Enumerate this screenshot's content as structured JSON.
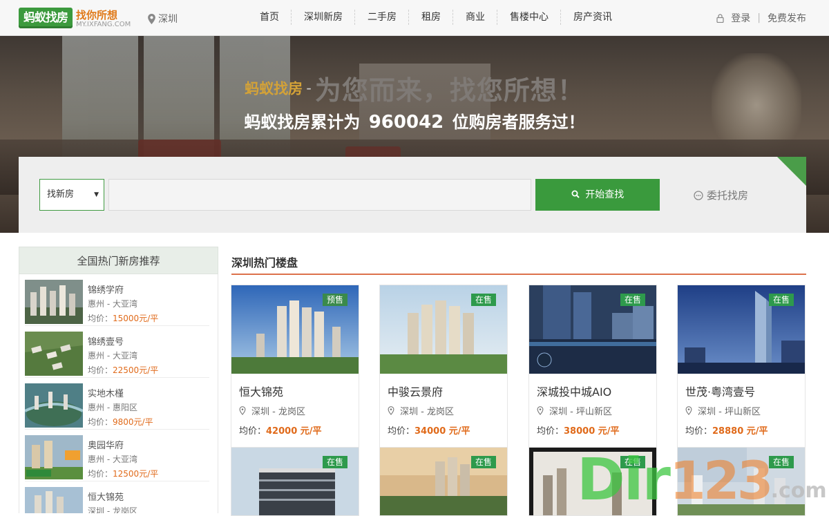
{
  "header": {
    "logo_text": "蚂蚁找房",
    "slogan": "找你所想",
    "domain": "MY.IXFANG.COM",
    "city": "深圳",
    "nav": [
      "首页",
      "深圳新房",
      "二手房",
      "租房",
      "商业",
      "售楼中心",
      "房产资讯"
    ],
    "login": "登录",
    "separator": "|",
    "publish": "免费发布"
  },
  "banner": {
    "brand": "蚂蚁找房",
    "dash": "-",
    "slogan": "为您而来，找您所想！",
    "served_prefix": "蚂蚁找房累计为",
    "served_count": "960042",
    "served_suffix": "位购房者服务过！"
  },
  "search": {
    "type_selected": "找新房",
    "type_caret": "▼",
    "input_value": "",
    "button_label": "开始查找",
    "entrust_label": "委托找房"
  },
  "sidebar": {
    "title": "全国热门新房推荐",
    "items": [
      {
        "name": "锦绣学府",
        "area": "惠州 - 大亚湾",
        "price_label": "均价：",
        "price": "15000元/平"
      },
      {
        "name": "锦绣壹号",
        "area": "惠州 - 大亚湾",
        "price_label": "均价：",
        "price": "22500元/平"
      },
      {
        "name": "实地木槿",
        "area": "惠州 - 惠阳区",
        "price_label": "均价：",
        "price": "9800元/平"
      },
      {
        "name": "奥园华府",
        "area": "惠州 - 大亚湾",
        "price_label": "均价：",
        "price": "12500元/平"
      },
      {
        "name": "恒大锦苑",
        "area": "深圳 - 龙岗区",
        "price_label": "",
        "price": ""
      }
    ]
  },
  "main": {
    "title": "深圳热门楼盘",
    "listings": [
      {
        "name": "恒大锦苑",
        "location": "深圳 - 龙岗区",
        "price_label": "均价：",
        "price": "42000 元/平",
        "status": "预售"
      },
      {
        "name": "中骏云景府",
        "location": "深圳 - 龙岗区",
        "price_label": "均价：",
        "price": "34000 元/平",
        "status": "在售"
      },
      {
        "name": "深城投中城AIO",
        "location": "深圳 - 坪山新区",
        "price_label": "均价：",
        "price": "38000 元/平",
        "status": "在售"
      },
      {
        "name": "世茂·粤湾壹号",
        "location": "深圳 - 坪山新区",
        "price_label": "均价：",
        "price": "28880 元/平",
        "status": "在售"
      }
    ],
    "second_row_status": [
      "在售",
      "在售",
      "在售",
      "在售"
    ]
  },
  "watermark": {
    "dir": "Dir",
    "num": "123",
    "com": ".com"
  },
  "colors": {
    "brand_green": "#3a9a3d",
    "price_orange": "#e06a1a",
    "accent_line": "#d6582a"
  }
}
